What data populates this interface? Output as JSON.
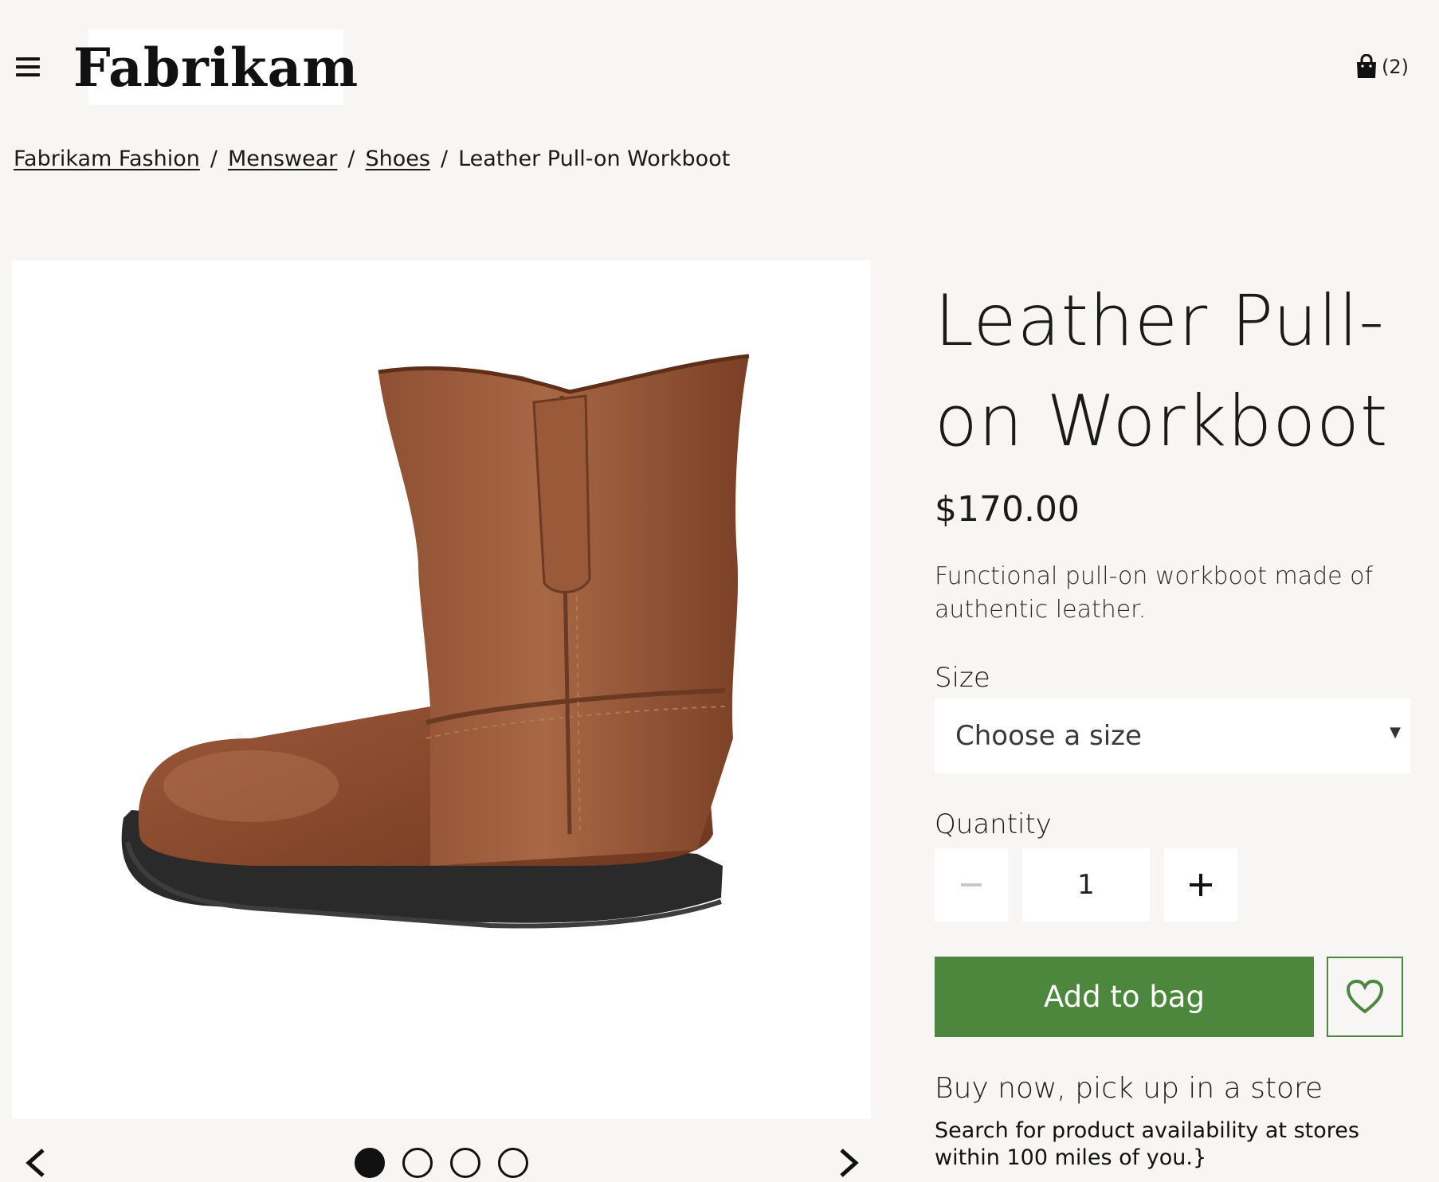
{
  "header": {
    "logo_text": "Fabrikam",
    "cart_count": "(2)"
  },
  "breadcrumb": {
    "items": [
      "Fabrikam Fashion",
      "Menswear",
      "Shoes"
    ],
    "current": "Leather Pull-on Workboot",
    "separator": "/"
  },
  "gallery": {
    "dot_count": 4,
    "active_index": 0
  },
  "product": {
    "title_line1": "Leather Pull-",
    "title_line2": "on Workboot",
    "price": "$170.00",
    "description": "Functional pull-on workboot made of authentic leather.",
    "size_label": "Size",
    "size_placeholder": "Choose a size",
    "quantity_label": "Quantity",
    "quantity_value": "1",
    "add_to_bag_label": "Add to bag",
    "pickup_title": "Buy now, pick up in a store",
    "pickup_text": "Search for product availability at stores within 100 miles of you.}"
  },
  "colors": {
    "accent": "#4c873d",
    "background": "#f7f6f4",
    "boot_leather": "#8a4a2e"
  },
  "icons": [
    "menu-icon",
    "shopping-bag-icon",
    "chevron-left-icon",
    "chevron-right-icon",
    "minus-icon",
    "plus-icon",
    "heart-icon"
  ]
}
